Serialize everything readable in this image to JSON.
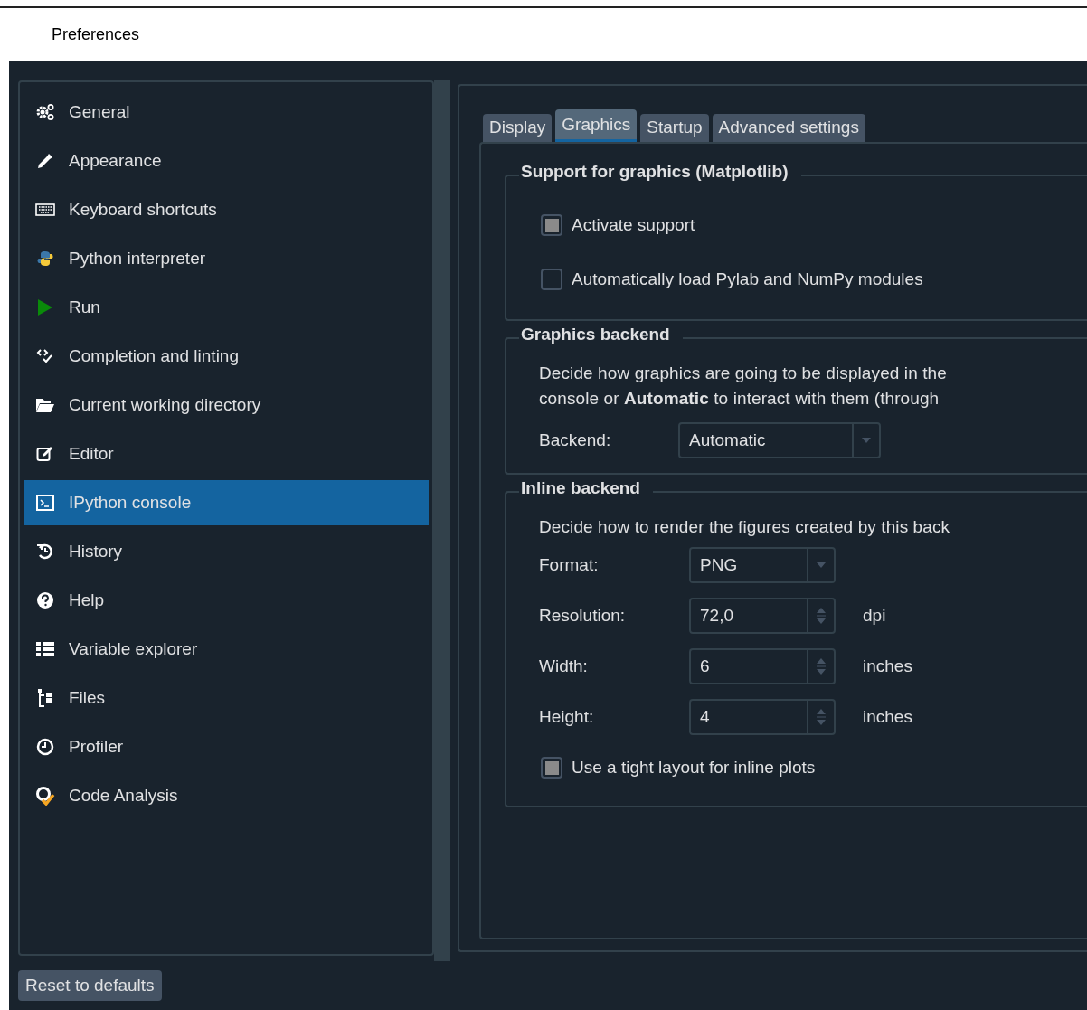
{
  "window": {
    "title": "Preferences"
  },
  "sidebar": {
    "items": [
      {
        "label": "General",
        "selected": false
      },
      {
        "label": "Appearance",
        "selected": false
      },
      {
        "label": "Keyboard shortcuts",
        "selected": false
      },
      {
        "label": "Python interpreter",
        "selected": false
      },
      {
        "label": "Run",
        "selected": false
      },
      {
        "label": "Completion and linting",
        "selected": false
      },
      {
        "label": "Current working directory",
        "selected": false
      },
      {
        "label": "Editor",
        "selected": false
      },
      {
        "label": "IPython console",
        "selected": true
      },
      {
        "label": "History",
        "selected": false
      },
      {
        "label": "Help",
        "selected": false
      },
      {
        "label": "Variable explorer",
        "selected": false
      },
      {
        "label": "Files",
        "selected": false
      },
      {
        "label": "Profiler",
        "selected": false
      },
      {
        "label": "Code Analysis",
        "selected": false
      }
    ]
  },
  "tabs": [
    {
      "label": "Display",
      "selected": false
    },
    {
      "label": "Graphics",
      "selected": true
    },
    {
      "label": "Startup",
      "selected": false
    },
    {
      "label": "Advanced settings",
      "selected": false
    }
  ],
  "matplotlib_support": {
    "title": "Support for graphics (Matplotlib)",
    "options": [
      {
        "label": "Activate support",
        "checked": true
      },
      {
        "label": "Automatically load Pylab and NumPy modules",
        "checked": false
      }
    ]
  },
  "graphics_backend": {
    "title": "Graphics backend",
    "description_lines": [
      "Decide how graphics are going to be displayed in the",
      "console or **Automatic** to interact with them (through"
    ],
    "backend_label": "Backend:",
    "backend_value": "Automatic"
  },
  "inline_backend": {
    "title": "Inline backend",
    "description": "Decide how to render the figures created by this back",
    "fields": [
      {
        "kind": "combo",
        "label": "Format:",
        "value": "PNG"
      },
      {
        "kind": "spin",
        "label": "Resolution:",
        "value": "72,0",
        "unit": "dpi"
      },
      {
        "kind": "spin",
        "label": "Width:",
        "value": "6",
        "unit": "inches"
      },
      {
        "kind": "spin",
        "label": "Height:",
        "value": "4",
        "unit": "inches"
      }
    ],
    "option": {
      "label": "Use a tight layout for inline plots",
      "checked": true
    }
  },
  "reset_button": "Reset to defaults"
}
